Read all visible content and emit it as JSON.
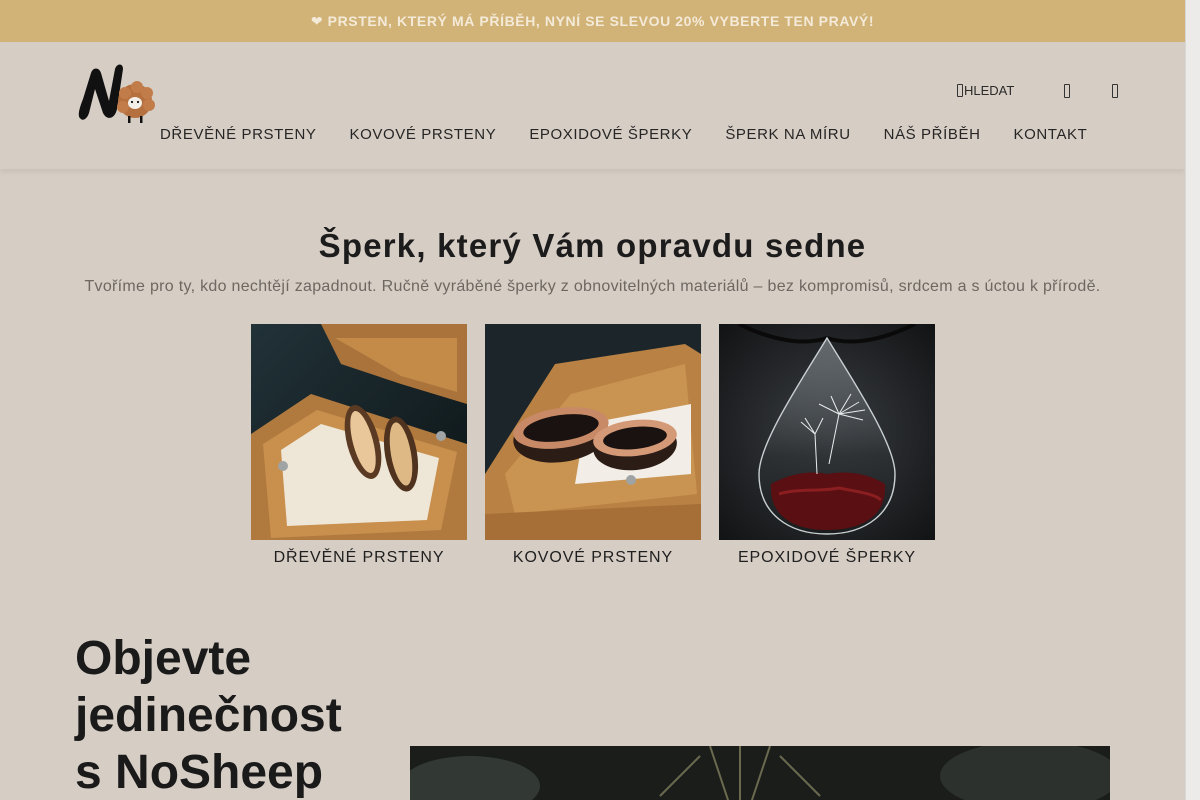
{
  "promo": {
    "text": "❤ PRSTEN, KTERÝ MÁ PŘÍBĚH, NYNÍ SE SLEVOU 20%  VYBERTE TEN PRAVÝ!"
  },
  "nav": [
    "DŘEVĚNÉ PRSTENY",
    "KOVOVÉ PRSTENY",
    "EPOXIDOVÉ ŠPERKY",
    "ŠPERK NA MÍRU",
    "NÁŠ PŘÍBĚH",
    "KONTAKT"
  ],
  "header": {
    "search_label": "HLEDAT",
    "icons": [
      "search-icon",
      "user-icon",
      "cart-icon"
    ]
  },
  "hero": {
    "title": "Šperk, který Vám opravdu sedne",
    "subtitle": "Tvoříme pro ty, kdo nechtějí zapadnout. Ručně vyráběné šperky z obnovitelných materiálů – bez kompromisů, srdcem a s úctou k přírodě."
  },
  "categories": [
    {
      "label": "DŘEVĚNÉ PRSTENY"
    },
    {
      "label": "KOVOVÉ PRSTENY"
    },
    {
      "label": "EPOXIDOVÉ ŠPERKY"
    }
  ],
  "intro": {
    "line1": "Objevte",
    "line2": "jedinečnost",
    "line3": "s NoSheep"
  },
  "colors": {
    "background": "#d6cdc4",
    "promo_bar": "#d1b277",
    "text": "#1e1e1e"
  }
}
